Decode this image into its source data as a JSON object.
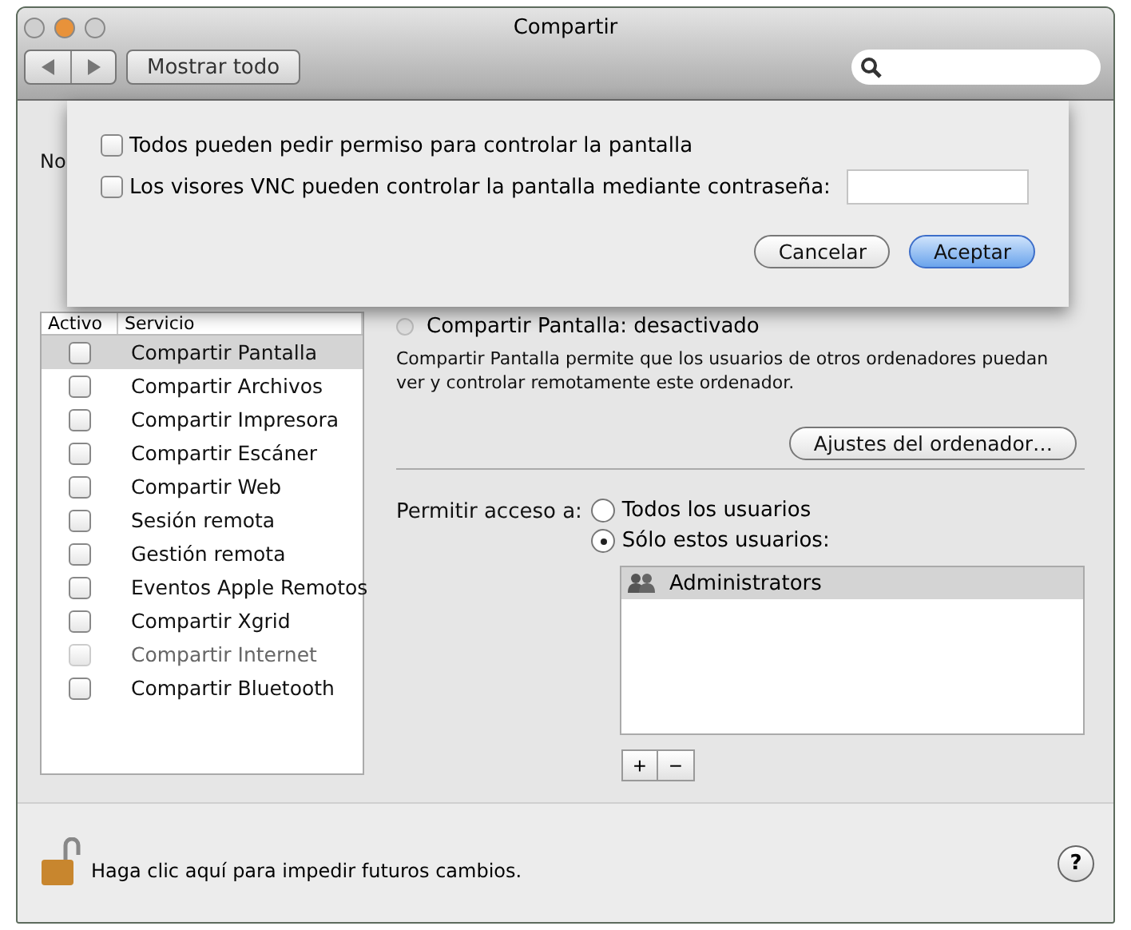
{
  "window": {
    "title": "Compartir"
  },
  "toolbar": {
    "show_all": "Mostrar todo"
  },
  "computer_name": {
    "label": "No"
  },
  "sheet": {
    "options": [
      {
        "label": "Todos pueden pedir permiso para controlar la pantalla",
        "checked": false
      },
      {
        "label": "Los visores VNC pueden controlar la pantalla mediante contraseña:",
        "checked": false,
        "kind": "password"
      }
    ],
    "buttons": [
      {
        "label": "Cancelar",
        "default": false
      },
      {
        "label": "Aceptar",
        "default": true
      }
    ]
  },
  "services": {
    "columns": [
      "Activo",
      "Servicio"
    ],
    "items": [
      {
        "name": "Compartir Pantalla",
        "checked": false,
        "selected": true,
        "disabled": false
      },
      {
        "name": "Compartir Archivos",
        "checked": false,
        "selected": false,
        "disabled": false
      },
      {
        "name": "Compartir Impresora",
        "checked": false,
        "selected": false,
        "disabled": false
      },
      {
        "name": "Compartir Escáner",
        "checked": false,
        "selected": false,
        "disabled": false
      },
      {
        "name": "Compartir Web",
        "checked": false,
        "selected": false,
        "disabled": false
      },
      {
        "name": "Sesión remota",
        "checked": false,
        "selected": false,
        "disabled": false
      },
      {
        "name": "Gestión remota",
        "checked": false,
        "selected": false,
        "disabled": false
      },
      {
        "name": "Eventos Apple Remotos",
        "checked": false,
        "selected": false,
        "disabled": false
      },
      {
        "name": "Compartir Xgrid",
        "checked": false,
        "selected": false,
        "disabled": false
      },
      {
        "name": "Compartir Internet",
        "checked": false,
        "selected": false,
        "disabled": true
      },
      {
        "name": "Compartir Bluetooth",
        "checked": false,
        "selected": false,
        "disabled": false
      }
    ]
  },
  "detail": {
    "status": "Compartir Pantalla: desactivado",
    "description": "Compartir Pantalla permite que los usuarios de otros ordenadores puedan ver y controlar remotamente este ordenador.",
    "settings_button": "Ajustes del ordenador…",
    "access_label": "Permitir acceso a:",
    "access_options": [
      {
        "label": "Todos los usuarios",
        "selected": false
      },
      {
        "label": "Sólo estos usuarios:",
        "selected": true
      }
    ],
    "users": [
      {
        "name": "Administrators",
        "selected": true
      }
    ],
    "add": "+",
    "remove": "−"
  },
  "footer": {
    "lock_text": "Haga clic aquí para impedir futuros cambios.",
    "help": "?"
  }
}
